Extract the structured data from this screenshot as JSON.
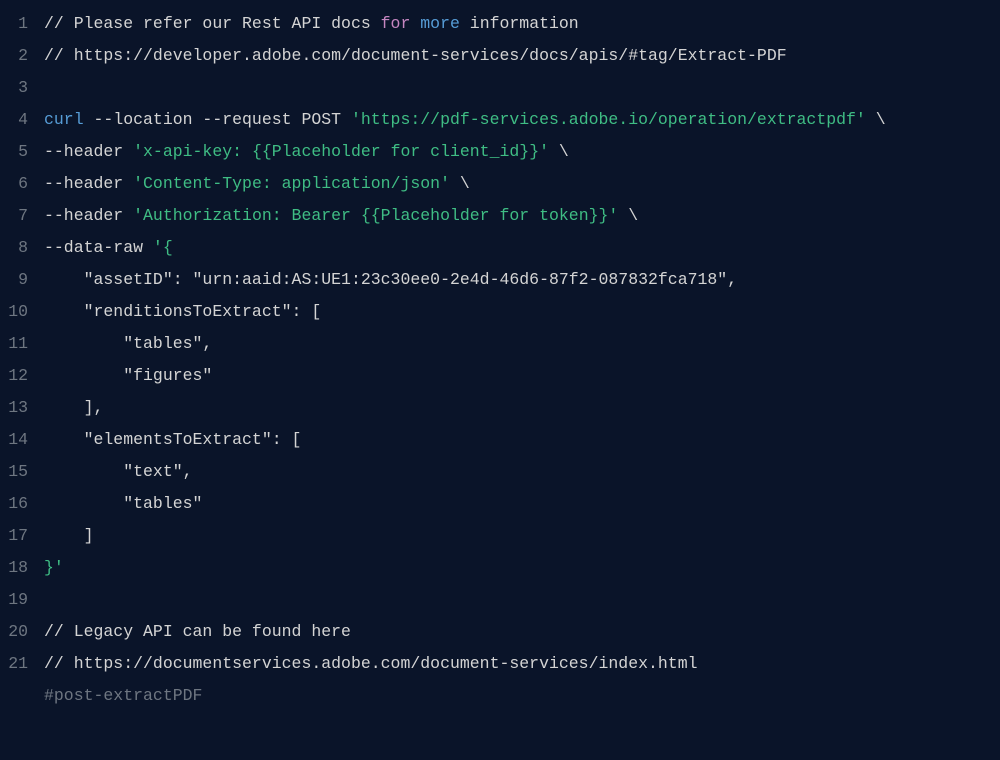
{
  "lines": {
    "numbers": [
      "1",
      "2",
      "3",
      "4",
      "5",
      "6",
      "7",
      "8",
      "9",
      "10",
      "11",
      "12",
      "13",
      "14",
      "15",
      "16",
      "17",
      "18",
      "19",
      "20",
      "21",
      ""
    ],
    "l1": {
      "a": "// Please refer our Rest API docs ",
      "for": "for",
      "sp1": " ",
      "more": "more",
      "b": " information"
    },
    "l2": {
      "a": "// https://developer.adobe.com/document-services/docs/apis/#tag/Extract-PDF"
    },
    "l3": "",
    "l4": {
      "cmd": "curl",
      "flags": " --location --request POST ",
      "url": "'https://pdf-services.adobe.io/operation/extractpdf'",
      "cont": " \\"
    },
    "l5": {
      "flag": "--header ",
      "str": "'x-api-key: {{Placeholder for client_id}}'",
      "cont": " \\"
    },
    "l6": {
      "flag": "--header ",
      "str": "'Content-Type: application/json'",
      "cont": " \\"
    },
    "l7": {
      "flag": "--header ",
      "str": "'Authorization: Bearer {{Placeholder for token}}'",
      "cont": " \\"
    },
    "l8": {
      "flag": "--data-raw ",
      "str": "'{"
    },
    "l9": {
      "str": "    \"assetID\": \"urn:aaid:AS:UE1:23c30ee0-2e4d-46d6-87f2-087832fca718\","
    },
    "l10": {
      "str": "    \"renditionsToExtract\": ["
    },
    "l11": {
      "str": "        \"tables\","
    },
    "l12": {
      "str": "        \"figures\""
    },
    "l13": {
      "str": "    ],"
    },
    "l14": {
      "str": "    \"elementsToExtract\": ["
    },
    "l15": {
      "str": "        \"text\","
    },
    "l16": {
      "str": "        \"tables\""
    },
    "l17": {
      "str": "    ]"
    },
    "l18": {
      "str": "}'"
    },
    "l19": "",
    "l20": {
      "a": "// Legacy API can be found here"
    },
    "l21": {
      "a": "// https://documentservices.adobe.com/document-services/index.html"
    },
    "l22": {
      "a": "#post-extractPDF"
    }
  }
}
